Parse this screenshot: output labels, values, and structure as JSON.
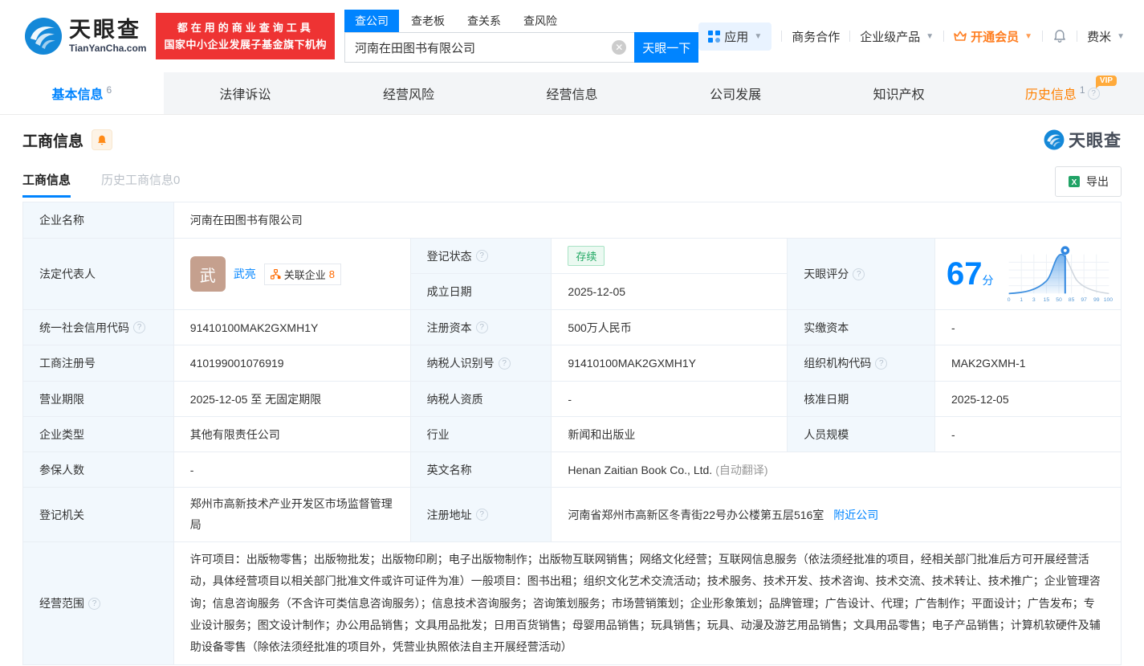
{
  "header": {
    "logo_title": "天眼查",
    "logo_domain": "TianYanCha.com",
    "slogan_line1": "都在用的商业查询工具",
    "slogan_line2": "国家中小企业发展子基金旗下机构",
    "search": {
      "tabs": [
        {
          "label": "查公司"
        },
        {
          "label": "查老板"
        },
        {
          "label": "查关系"
        },
        {
          "label": "查风险"
        }
      ],
      "value": "河南在田图书有限公司",
      "button_label": "天眼一下"
    },
    "nav": {
      "apps_label": "应用",
      "business_coop": "商务合作",
      "enterprise_product": "企业级产品",
      "vip_label": "开通会员",
      "username": "费米"
    }
  },
  "main_tabs": {
    "vip_badge": "VIP",
    "items": [
      {
        "label": "基本信息",
        "count": "6"
      },
      {
        "label": "法律诉讼",
        "count": ""
      },
      {
        "label": "经营风险",
        "count": ""
      },
      {
        "label": "经营信息",
        "count": ""
      },
      {
        "label": "公司发展",
        "count": ""
      },
      {
        "label": "知识产权",
        "count": ""
      },
      {
        "label": "历史信息",
        "count": "1"
      }
    ]
  },
  "section": {
    "title": "工商信息",
    "watermark": "天眼查",
    "subtab_current": "工商信息",
    "subtab_history": "历史工商信息0",
    "export_label": "导出"
  },
  "info": {
    "company_name_label": "企业名称",
    "company_name": "河南在田图书有限公司",
    "legal_rep_label": "法定代表人",
    "legal_rep_avatar": "武",
    "legal_rep_name": "武亮",
    "related_label": "关联企业",
    "related_count": "8",
    "reg_status_label": "登记状态",
    "reg_status": "存续",
    "establish_label": "成立日期",
    "establish_date": "2025-12-05",
    "score_label": "天眼评分",
    "score_value": "67",
    "score_unit": "分",
    "credit_code_label": "统一社会信用代码",
    "credit_code": "91410100MAK2GXMH1Y",
    "reg_capital_label": "注册资本",
    "reg_capital": "500万人民币",
    "paid_capital_label": "实缴资本",
    "paid_capital": "-",
    "reg_number_label": "工商注册号",
    "reg_number": "410199001076919",
    "taxpayer_id_label": "纳税人识别号",
    "taxpayer_id": "91410100MAK2GXMH1Y",
    "org_code_label": "组织机构代码",
    "org_code": "MAK2GXMH-1",
    "business_term_label": "营业期限",
    "business_term": "2025-12-05 至 无固定期限",
    "taxpayer_quality_label": "纳税人资质",
    "taxpayer_quality": "-",
    "approval_date_label": "核准日期",
    "approval_date": "2025-12-05",
    "company_type_label": "企业类型",
    "company_type": "其他有限责任公司",
    "industry_label": "行业",
    "industry": "新闻和出版业",
    "staff_size_label": "人员规模",
    "staff_size": "-",
    "insured_label": "参保人数",
    "insured": "-",
    "english_name_label": "英文名称",
    "english_name": "Henan Zaitian Book Co., Ltd.",
    "english_name_note": "(自动翻译)",
    "reg_authority_label": "登记机关",
    "reg_authority": "郑州市高新技术产业开发区市场监督管理局",
    "address_label": "注册地址",
    "address": "河南省郑州市高新区冬青街22号办公楼第五层516室",
    "nearby_link": "附近公司",
    "business_scope_label": "经营范围",
    "business_scope": "许可项目：出版物零售；出版物批发；出版物印刷；电子出版物制作；出版物互联网销售；网络文化经营；互联网信息服务（依法须经批准的项目，经相关部门批准后方可开展经营活动，具体经营项目以相关部门批准文件或许可证件为准）一般项目：图书出租；组织文化艺术交流活动；技术服务、技术开发、技术咨询、技术交流、技术转让、技术推广；企业管理咨询；信息咨询服务（不含许可类信息咨询服务）；信息技术咨询服务；咨询策划服务；市场营销策划；企业形象策划；品牌管理；广告设计、代理；广告制作；平面设计；广告发布；专业设计服务；图文设计制作；办公用品销售；文具用品批发；日用百货销售；母婴用品销售；玩具销售；玩具、动漫及游艺用品销售；文具用品零售；电子产品销售；计算机软硬件及辅助设备零售（除依法须经批准的项目外，凭营业执照依法自主开展经营活动）"
  },
  "chart_data": {
    "type": "area",
    "title": "天眼评分",
    "score": 67,
    "marker_value": 67,
    "x_ticks": [
      "0",
      "1",
      "3",
      "15",
      "50",
      "85",
      "97",
      "99",
      "100"
    ],
    "note": "score percentile bell curve, blue filled left of marker"
  },
  "colors": {
    "primary_blue": "#0084ff",
    "banner_red": "#ee3333",
    "vip_orange": "#ff8000",
    "status_green": "#20a862",
    "label_cell_bg": "#f2f8fd"
  }
}
